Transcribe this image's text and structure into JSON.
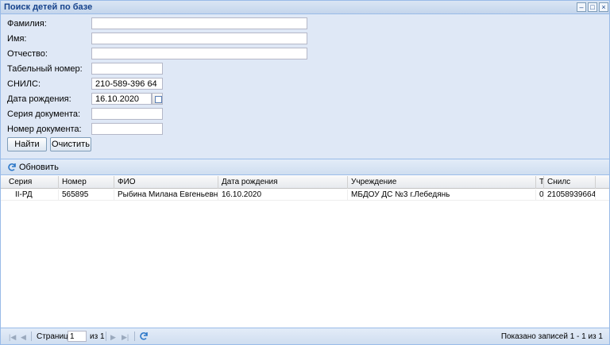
{
  "window": {
    "title": "Поиск детей по базе"
  },
  "form": {
    "fields": [
      {
        "label": "Фамилия:",
        "value": "",
        "width": 270
      },
      {
        "label": "Имя:",
        "value": ""
      },
      {
        "label": "Отчество:",
        "value": ""
      },
      {
        "label": "Табельный номер:",
        "value": ""
      },
      {
        "label": "СНИЛС:",
        "value": "210-589-396 64"
      },
      {
        "label": "Дата рождения:",
        "value": "16.10.2020"
      },
      {
        "label": "Серия документа:",
        "value": ""
      },
      {
        "label": "Номер документа:",
        "value": ""
      }
    ],
    "find_label": "Найти",
    "clear_label": "Очистить"
  },
  "grid": {
    "refresh_label": "Обновить",
    "columns": [
      "Серия",
      "Номер",
      "ФИО",
      "Дата рождения",
      "Учреждение",
      "Т",
      "Снилс"
    ],
    "rows": [
      [
        "II-РД",
        "565895",
        "Рыбина Милана Евгеньевна",
        "16.10.2020",
        "МБДОУ ДС №3 г.Лебедянь",
        "0",
        "21058939664"
      ]
    ]
  },
  "pager": {
    "page_label": "Страница",
    "page_value": "1",
    "of_label": "из 1",
    "summary": "Показано записей 1 - 1 из 1"
  }
}
